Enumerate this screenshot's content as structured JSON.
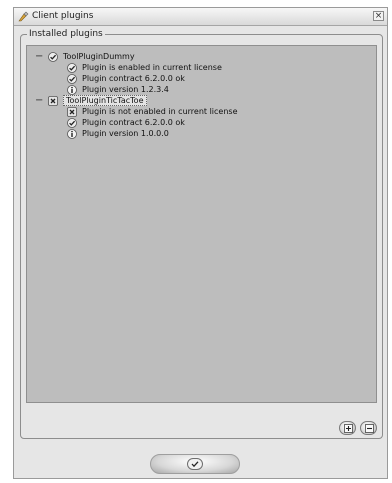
{
  "window": {
    "title": "Client plugins",
    "close_glyph": "×"
  },
  "groupbox": {
    "title": "Installed plugins"
  },
  "tree": {
    "plugins": [
      {
        "name": "ToolPluginDummy",
        "status_icon": "check-badge-icon",
        "expander": "−",
        "details": [
          {
            "icon": "check-badge-icon",
            "text": "Plugin is enabled in current license"
          },
          {
            "icon": "check-badge-icon",
            "text": "Plugin contract 6.2.0.0 ok"
          },
          {
            "icon": "info-icon",
            "text": "Plugin version 1.2.3.4"
          }
        ]
      },
      {
        "name": "ToolPluginTicTacToe",
        "status_icon": "error-x-icon",
        "expander": "−",
        "selected": true,
        "details": [
          {
            "icon": "error-x-icon",
            "text": "Plugin is not enabled in current license"
          },
          {
            "icon": "check-badge-icon",
            "text": "Plugin contract 6.2.0.0 ok"
          },
          {
            "icon": "info-icon",
            "text": "Plugin version 1.0.0.0"
          }
        ]
      }
    ]
  },
  "toolbar": {
    "buttons": [
      "expand-all-icon",
      "collapse-all-icon"
    ]
  },
  "footer": {
    "ok_icon": "checkmark-icon"
  }
}
